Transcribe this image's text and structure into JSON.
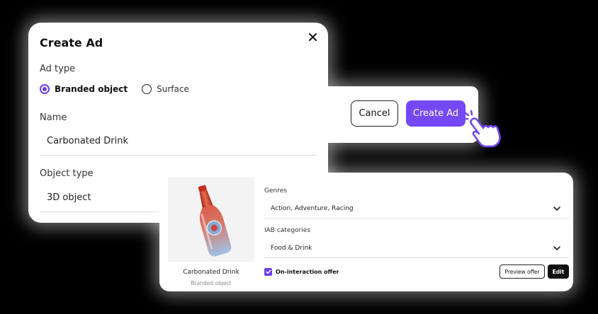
{
  "dialog": {
    "title": "Create Ad",
    "ad_type_label": "Ad type",
    "ad_types": [
      {
        "label": "Branded object",
        "selected": true
      },
      {
        "label": "Surface",
        "selected": false
      }
    ],
    "name_label": "Name",
    "name_value": "Carbonated Drink",
    "object_type_label": "Object type",
    "object_type_value": "3D object"
  },
  "actions": {
    "cancel_label": "Cancel",
    "create_label": "Create Ad"
  },
  "card": {
    "thumbnail_icon": "bottle-icon",
    "name": "Carbonated Drink",
    "subtitle": "Branded object",
    "genres_label": "Genres",
    "genres_value": "Action, Adventure, Racing",
    "iab_label": "IAB categories",
    "iab_value": "Food & Drink",
    "offer_label": "On-interaction offer",
    "offer_checked": true,
    "preview_label": "Preview offer",
    "edit_label": "Edit"
  },
  "colors": {
    "accent": "#7448f5",
    "background": "#000000",
    "panel": "#ffffff"
  }
}
